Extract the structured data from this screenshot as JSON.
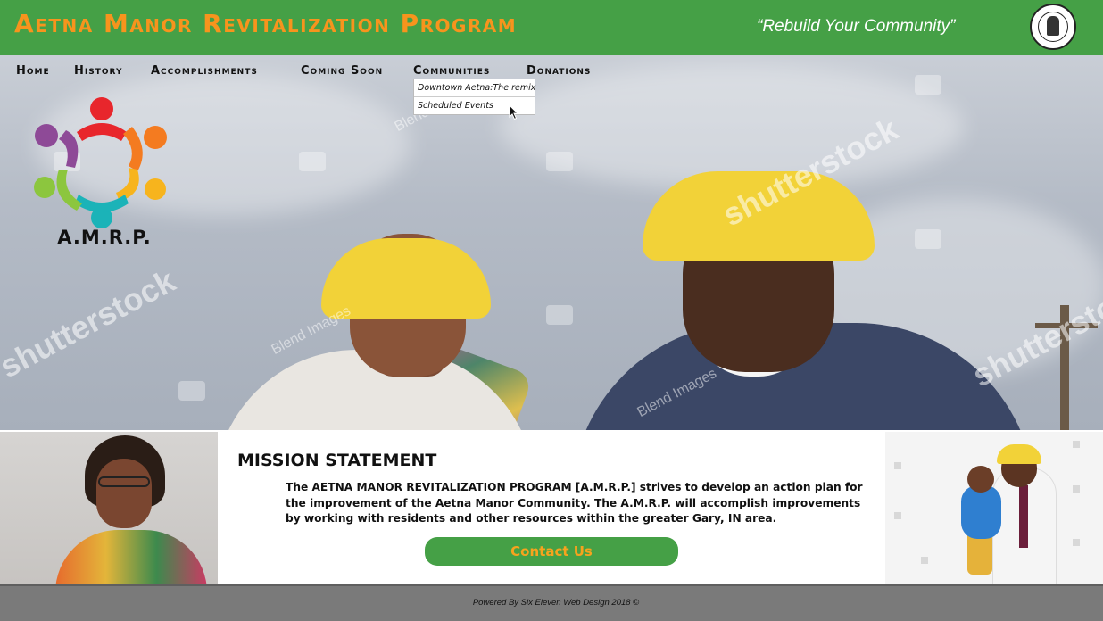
{
  "header": {
    "title": "Aetna Manor Revitalization Program",
    "tagline": "“Rebuild Your Community”",
    "seal_icon": "city-seal-icon"
  },
  "nav": {
    "items": [
      {
        "label": "Home"
      },
      {
        "label": "History"
      },
      {
        "label": "Accomplishments"
      },
      {
        "label": "Coming Soon"
      },
      {
        "label": "Communities"
      },
      {
        "label": "Donations"
      }
    ],
    "communities_dropdown": [
      {
        "label": "Downtown Aetna:The remix"
      },
      {
        "label": "Scheduled Events"
      }
    ]
  },
  "logo": {
    "text": "A.M.R.P.",
    "colors": [
      "#e8262c",
      "#f47b20",
      "#f7b41d",
      "#8cc63e",
      "#1bb3b8",
      "#8e4a97"
    ]
  },
  "hero": {
    "watermark": "shutterstock",
    "watermark_credit": "Blend Images"
  },
  "mission": {
    "title": "MISSION STATEMENT",
    "text": "The AETNA MANOR REVITALIZATION PROGRAM [A.M.R.P.] strives to develop an action plan for the improvement of the Aetna Manor Community.  The A.M.R.P. will accomplish improvements by working with residents and other resources within the greater Gary, IN area.",
    "contact_label": "Contact Us"
  },
  "footer": {
    "text": "Powered By Six Eleven Web Design 2018 ©"
  },
  "colors": {
    "brand_green": "#45a046",
    "brand_orange": "#f7941d",
    "footer_gray": "#7a7a7a"
  }
}
